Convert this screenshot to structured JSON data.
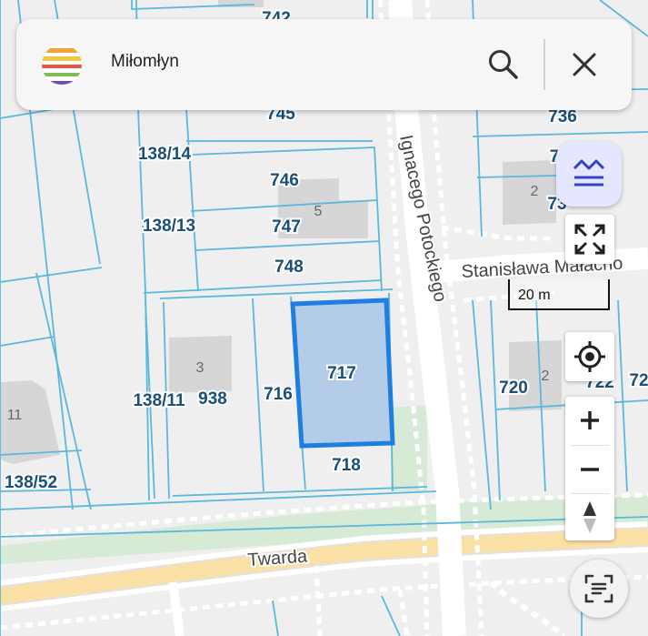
{
  "search": {
    "query": "Miłomłyn"
  },
  "colors": {
    "parcel_line": "#5bb8dc",
    "selection": "#1f7fe0",
    "label": "#1a4f78",
    "road_yellow": "#fbe0a6",
    "accent": "#3341c2"
  },
  "icons": {
    "logo": "rainbow-logo-icon",
    "search": "search-icon",
    "close": "close-icon",
    "layers": "layers-icon",
    "fullscreen": "fullscreen-icon",
    "locate": "locate-icon",
    "zoom_in": "plus-icon",
    "zoom_out": "minus-icon",
    "compass": "compass-icon",
    "scan": "scan-text-icon"
  },
  "scale": {
    "label": "20 m"
  },
  "streets": {
    "twarda": "Twarda",
    "potockiego": "Ignacego Potockiego",
    "staszica": "Stanisława Małacho"
  },
  "parcels": {
    "p742": "742",
    "p745": "745",
    "p736": "736",
    "p7a": "7",
    "p73": "73",
    "p138_14": "138/14",
    "p746": "746",
    "p747": "747",
    "p138_13": "138/13",
    "p748": "748",
    "p717": "717",
    "p716": "716",
    "p138_11": "138/11",
    "p938": "938",
    "p720": "720",
    "p722": "722",
    "p72": "72",
    "p718": "718",
    "p138_52": "138/52"
  },
  "buildings": {
    "b5": "5",
    "b3": "3",
    "b11": "11",
    "b2a": "2",
    "b2b": "2"
  }
}
